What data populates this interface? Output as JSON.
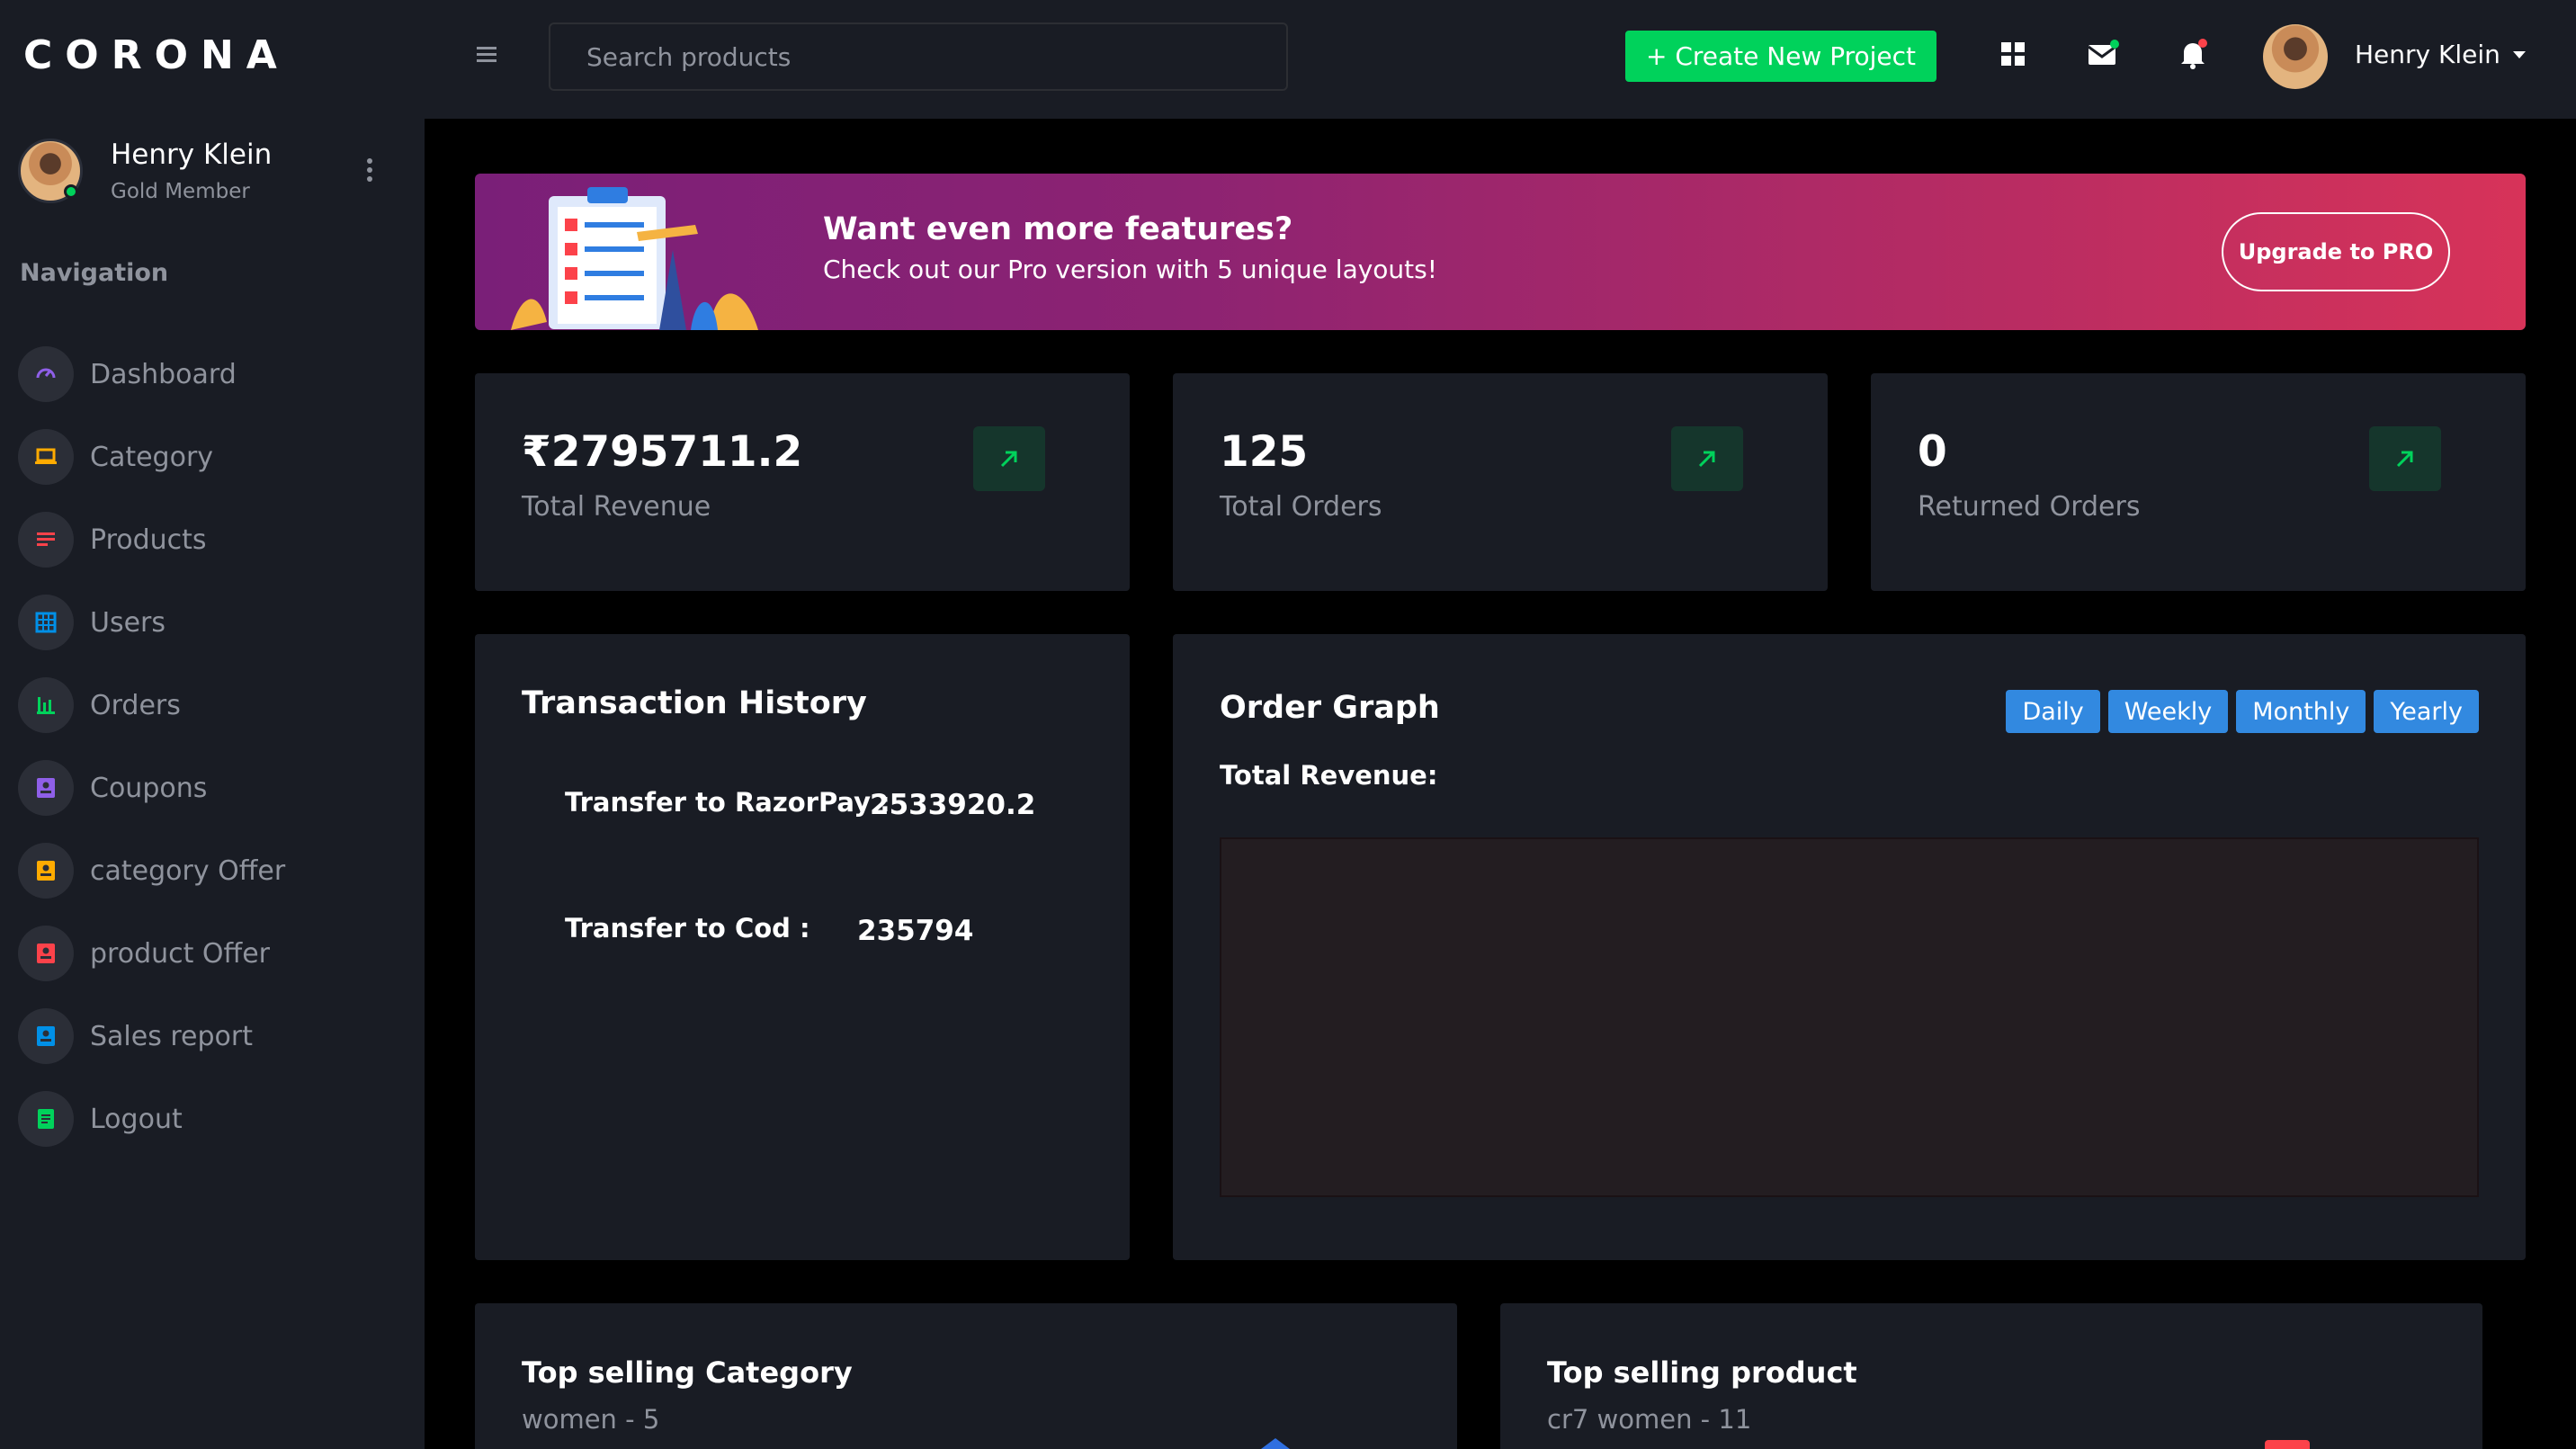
{
  "brand": "CORONA",
  "sidebar": {
    "profile": {
      "name": "Henry Klein",
      "role": "Gold Member"
    },
    "nav_heading": "Navigation",
    "items": [
      {
        "label": "Dashboard",
        "icon": "speedometer-icon",
        "color": "#8f5fe8"
      },
      {
        "label": "Category",
        "icon": "laptop-icon",
        "color": "#ffab00"
      },
      {
        "label": "Products",
        "icon": "list-icon",
        "color": "#fc424a"
      },
      {
        "label": "Users",
        "icon": "table-icon",
        "color": "#0090e7"
      },
      {
        "label": "Orders",
        "icon": "chart-icon",
        "color": "#00d25b"
      },
      {
        "label": "Coupons",
        "icon": "contact-icon",
        "color": "#8f5fe8"
      },
      {
        "label": "category Offer",
        "icon": "contact-icon",
        "color": "#ffab00"
      },
      {
        "label": "product Offer",
        "icon": "contact-icon",
        "color": "#fc424a"
      },
      {
        "label": "Sales report",
        "icon": "contact-icon",
        "color": "#0090e7"
      },
      {
        "label": "Logout",
        "icon": "document-icon",
        "color": "#00d25b"
      }
    ]
  },
  "topbar": {
    "search_placeholder": "Search products",
    "create_label": "+ Create New Project",
    "user_name": "Henry Klein"
  },
  "banner": {
    "title": "Want even more features?",
    "subtitle": "Check out our Pro version with 5 unique layouts!",
    "button": "Upgrade to PRO"
  },
  "stats": [
    {
      "value": "₹2795711.2",
      "label": "Total Revenue"
    },
    {
      "value": "125",
      "label": "Total Orders"
    },
    {
      "value": "0",
      "label": "Returned Orders"
    }
  ],
  "transactions": {
    "title": "Transaction History",
    "rows": [
      {
        "label": "Transfer to RazorPay :",
        "value": "2533920.2"
      },
      {
        "label": "Transfer to Cod :",
        "value": "235794"
      }
    ]
  },
  "order_graph": {
    "title": "Order Graph",
    "subtitle": "Total Revenue:",
    "tabs": [
      "Daily",
      "Weekly",
      "Monthly",
      "Yearly"
    ]
  },
  "top_category": {
    "title": "Top selling Category",
    "value": "women - 5"
  },
  "top_product": {
    "title": "Top selling product",
    "value": "cr7 women - 11"
  },
  "colors": {
    "sidebar_bg": "#191c24",
    "page_bg": "#000000",
    "accent_green": "#00d25b",
    "tab_blue": "#3289e0",
    "muted_text": "#8f939d"
  }
}
